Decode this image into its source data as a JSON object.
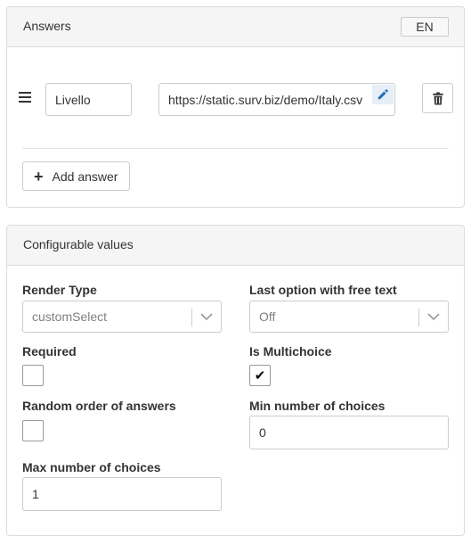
{
  "answers_panel": {
    "title": "Answers",
    "language": "EN",
    "items": [
      {
        "label": "Livello",
        "url": "https://static.surv.biz/demo/Italy.csv"
      }
    ],
    "add_label": "Add answer"
  },
  "config_panel": {
    "title": "Configurable values",
    "render_type": {
      "label": "Render Type",
      "value": "customSelect"
    },
    "last_option_free_text": {
      "label": "Last option with free text",
      "value": "Off"
    },
    "required": {
      "label": "Required",
      "checked": false
    },
    "is_multichoice": {
      "label": "Is Multichoice",
      "checked": true,
      "mark": "✔"
    },
    "random_order": {
      "label": "Random order of answers",
      "checked": false
    },
    "min_choices": {
      "label": "Min number of choices",
      "value": "0"
    },
    "max_choices": {
      "label": "Max number of choices",
      "value": "1"
    }
  },
  "icons": {
    "drag": "drag-handle-icon",
    "edit": "pencil-icon",
    "delete": "trash-icon",
    "add": "plus-icon",
    "chevron": "chevron-down-icon",
    "edit_color": "#2a6ebb"
  }
}
